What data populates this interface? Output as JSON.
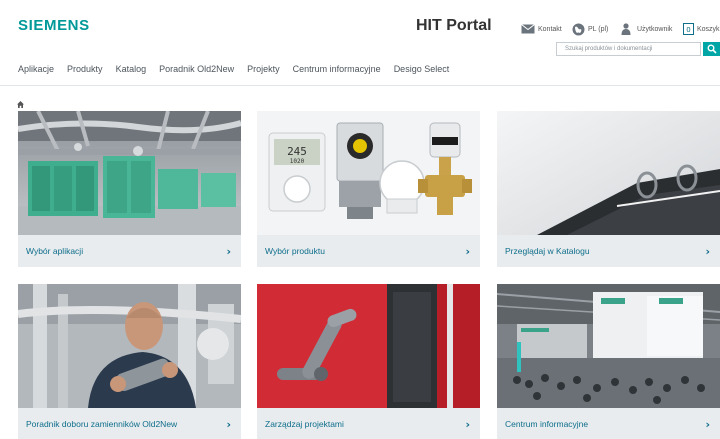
{
  "header": {
    "logo": "SIEMENS",
    "title": "HIT Portal",
    "utility": {
      "contact": "Kontakt",
      "language": "PL (pl)",
      "user": "Użytkownik",
      "cart": "Koszyk"
    },
    "search": {
      "placeholder": "Szukaj produktów i dokumentacji"
    }
  },
  "nav": [
    "Aplikacje",
    "Produkty",
    "Katalog",
    "Poradnik Old2New",
    "Projekty",
    "Centrum informacyjne",
    "Desigo Select"
  ],
  "tiles": [
    {
      "label": "Wybór aplikacji"
    },
    {
      "label": "Wybór produktu"
    },
    {
      "label": "Przeglądaj w Katalogu"
    },
    {
      "label": "Poradnik doboru zamienników Old2New"
    },
    {
      "label": "Zarządzaj projektami"
    },
    {
      "label": "Centrum informacyjne"
    }
  ],
  "thermostat_display": {
    "main": "245",
    "sub": "1020"
  },
  "colors": {
    "brand": "#009999",
    "link": "#0f6e8c",
    "tile_bar": "#e8ecee",
    "search_button": "#00a6a6"
  }
}
